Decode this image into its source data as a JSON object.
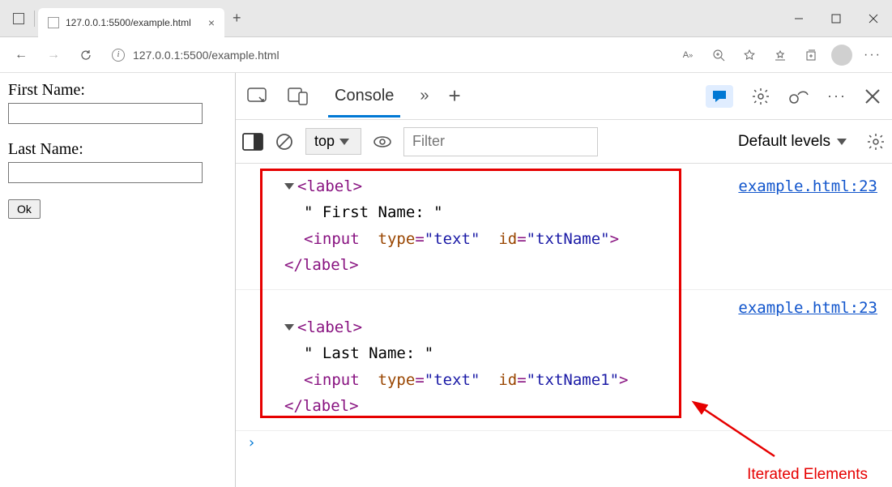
{
  "window": {
    "tab_title": "127.0.0.1:5500/example.html",
    "url": "127.0.0.1:5500/example.html"
  },
  "page": {
    "label1": "First Name:",
    "label2": "Last Name:",
    "button": "Ok"
  },
  "devtools": {
    "active_tab": "Console",
    "scope": "top",
    "filter_placeholder": "Filter",
    "levels": "Default levels",
    "source_link": "example.html:23",
    "log1": {
      "open": "<label>",
      "text": "\" First Name: \"",
      "input_tag": "<input",
      "type_attr": "type",
      "type_val": "\"text\"",
      "id_attr": "id",
      "id_val": "\"txtName\"",
      "input_close": ">",
      "close": "</label>"
    },
    "log2": {
      "open": "<label>",
      "text": "\" Last Name: \"",
      "input_tag": "<input",
      "type_attr": "type",
      "type_val": "\"text\"",
      "id_attr": "id",
      "id_val": "\"txtName1\"",
      "input_close": ">",
      "close": "</label>"
    }
  },
  "annotation": "Iterated Elements"
}
